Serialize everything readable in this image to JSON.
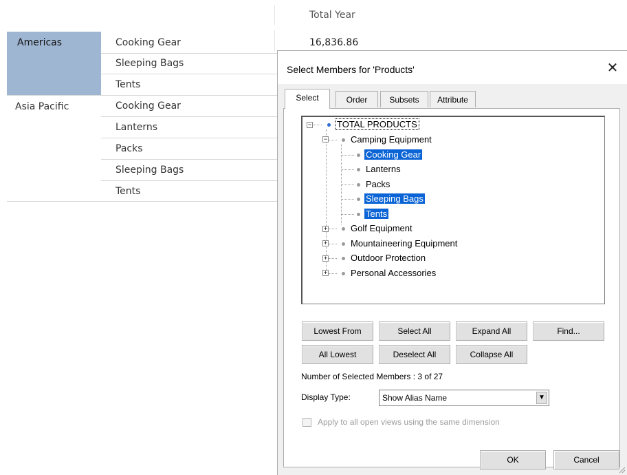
{
  "grid": {
    "column_header": "Total Year",
    "rows": [
      {
        "region": "Americas",
        "product": "Cooking Gear",
        "value": "16,836.86"
      },
      {
        "region": "",
        "product": "Sleeping Bags",
        "value": ""
      },
      {
        "region": "",
        "product": "Tents",
        "value": ""
      },
      {
        "region": "Asia Pacific",
        "product": "Cooking Gear",
        "value": ""
      },
      {
        "region": "",
        "product": "Lanterns",
        "value": ""
      },
      {
        "region": "",
        "product": "Packs",
        "value": ""
      },
      {
        "region": "",
        "product": "Sleeping Bags",
        "value": ""
      },
      {
        "region": "",
        "product": "Tents",
        "value": ""
      }
    ]
  },
  "dialog": {
    "title": "Select Members for 'Products'",
    "close_glyph": "✕",
    "tabs": [
      "Select",
      "Order",
      "Subsets",
      "Attribute"
    ],
    "tree": {
      "root": "TOTAL PRODUCTS",
      "group": "Camping Equipment",
      "children": [
        "Cooking Gear",
        "Lanterns",
        "Packs",
        "Sleeping Bags",
        "Tents"
      ],
      "selected": [
        "Cooking Gear",
        "Sleeping Bags",
        "Tents"
      ],
      "collapsed": [
        "Golf Equipment",
        "Mountaineering Equipment",
        "Outdoor Protection",
        "Personal Accessories"
      ]
    },
    "buttons": {
      "lowest_from": "Lowest From",
      "select_all": "Select All",
      "expand_all": "Expand All",
      "find": "Find...",
      "all_lowest": "All Lowest",
      "deselect_all": "Deselect All",
      "collapse_all": "Collapse All",
      "ok": "OK",
      "cancel": "Cancel"
    },
    "selection_count": "Number of Selected Members : 3 of 27",
    "display_type_label": "Display Type:",
    "display_type_value": "Show Alias Name",
    "apply_all_label": "Apply to all open views using the same dimension",
    "colors": {
      "selection": "#0a64d6",
      "region_highlight": "#9fb6d3"
    }
  }
}
